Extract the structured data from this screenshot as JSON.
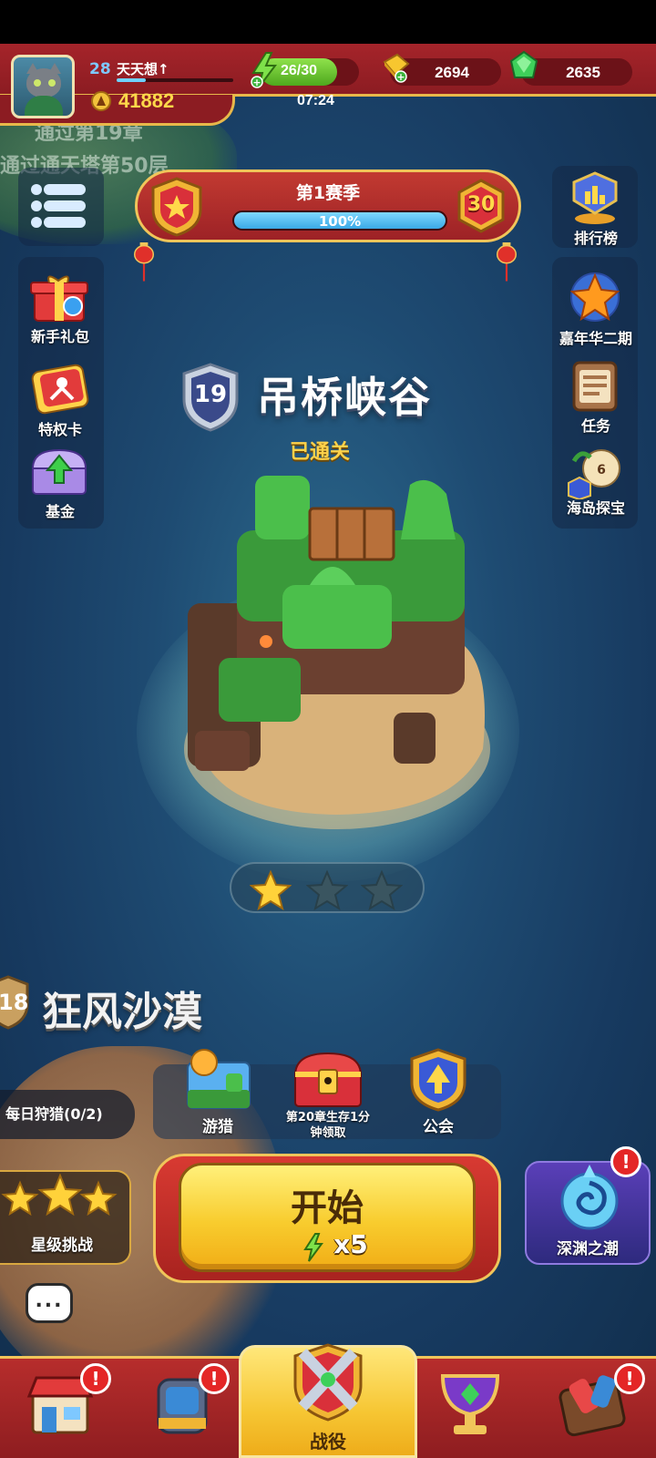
{
  "player": {
    "level": "28",
    "name": "天天想↑",
    "power": "41882"
  },
  "resources": {
    "energy": "26/30",
    "energy_timer": "07:24",
    "gold": "2694",
    "gems": "2635"
  },
  "background_text": {
    "line1": "通过第19章",
    "line2": "通过通天塔第50层"
  },
  "season": {
    "title": "第1赛季",
    "progress_text": "100%",
    "progress": 1.0,
    "level": "30"
  },
  "left_menu": {
    "items": [
      {
        "label": "新手礼包",
        "icon": "gift-box-icon"
      },
      {
        "label": "特权卡",
        "icon": "privilege-card-icon"
      },
      {
        "label": "基金",
        "icon": "fund-chest-icon"
      }
    ]
  },
  "right_menu": {
    "leaderboard": "排行榜",
    "items": [
      {
        "label": "嘉年华二期",
        "icon": "carnival-star-icon"
      },
      {
        "label": "任务",
        "icon": "task-scroll-icon"
      },
      {
        "label": "海岛探宝",
        "icon": "island-treasure-icon"
      }
    ]
  },
  "stage": {
    "number": "19",
    "name": "吊桥峡谷",
    "status": "已通关",
    "stars_earned": 1,
    "stars_total": 3
  },
  "next_stage": {
    "number": "18",
    "name": "狂风沙漠"
  },
  "quick_actions": {
    "daily_hunt": "每日狩猎(0/2)",
    "hunt": "游猎",
    "chest": "第20章生存1分钟领取",
    "chest_line1": "第20章生存1分",
    "chest_line2": "钟领取",
    "guild": "公会"
  },
  "start": {
    "label": "开始",
    "cost": "x5"
  },
  "star_challenge": "星级挑战",
  "abyss": "深渊之潮",
  "badge_text": "!",
  "chat_icon": "...",
  "nav": {
    "active_label": "战役",
    "items": [
      "shop-icon",
      "equipment-icon",
      "campaign-swords-icon",
      "trophy-cup-icon",
      "event-icon"
    ]
  },
  "colors": {
    "top_bar": "#a5242a",
    "gold_border": "#f0c55a",
    "start_button": "#f8cc2e",
    "notification": "#e42626"
  }
}
